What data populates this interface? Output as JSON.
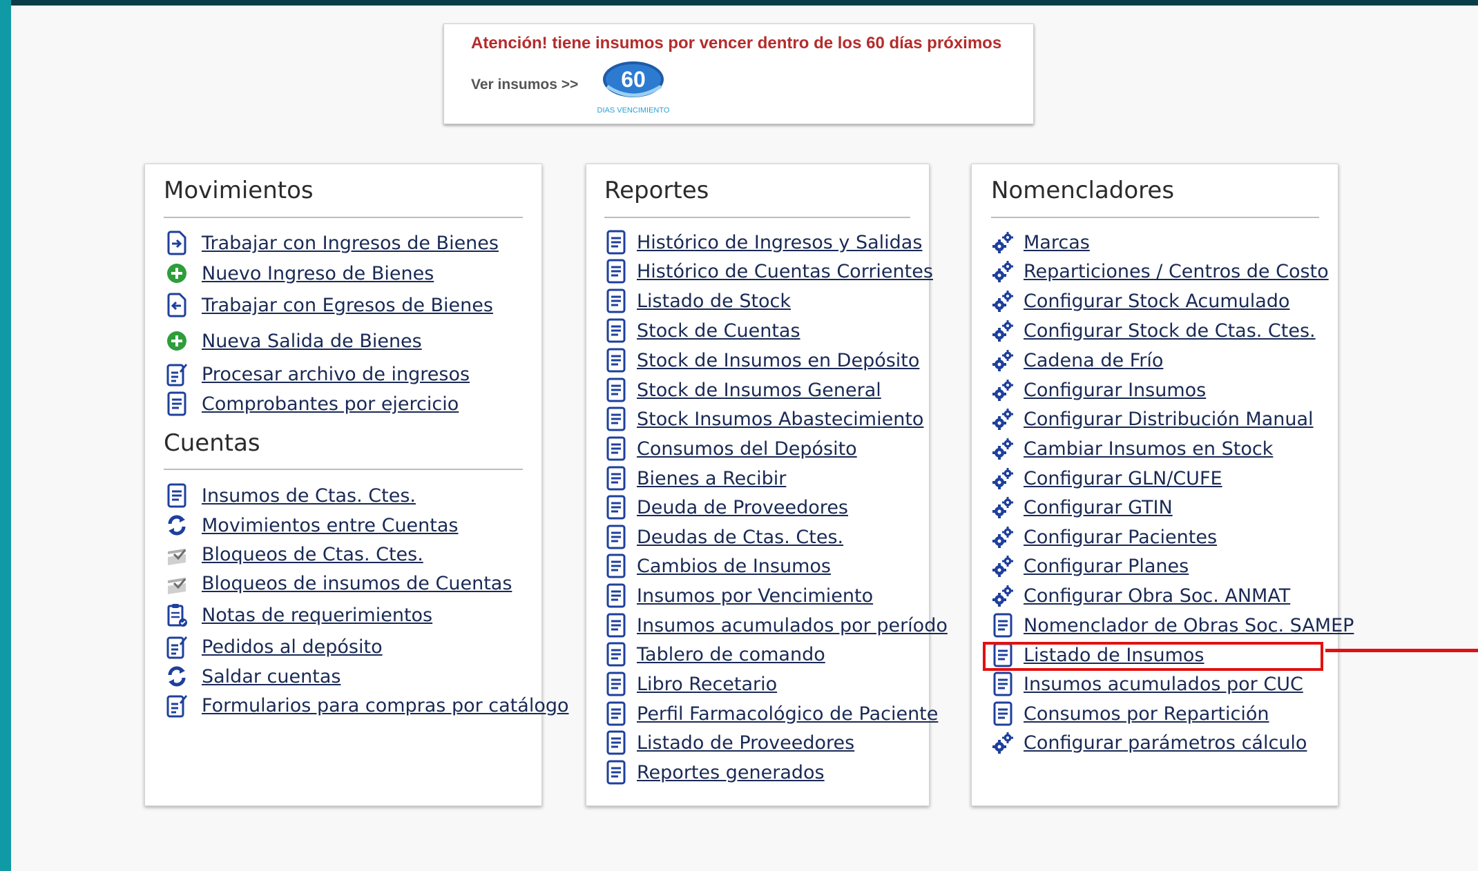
{
  "alert": {
    "title": "Atención! tiene insumos por vencer dentro de los 60 días próximos",
    "link": "Ver insumos >>",
    "badge_number": "60",
    "badge_caption": "DIAS VENCIMIENTO"
  },
  "movimientos": {
    "title": "Movimientos",
    "items": [
      {
        "label": "Trabajar con Ingresos de Bienes",
        "icon": "doc-in-icon"
      },
      {
        "label": "Nuevo Ingreso de Bienes",
        "icon": "plus-circle-icon"
      },
      {
        "label": "Trabajar con Egresos de Bienes",
        "icon": "doc-out-icon"
      },
      {
        "label": "Nueva Salida de Bienes",
        "icon": "plus-circle-icon"
      },
      {
        "label": "Procesar archivo de ingresos",
        "icon": "doc-edit-icon"
      },
      {
        "label": "Comprobantes por ejercicio",
        "icon": "doc-list-icon"
      }
    ]
  },
  "cuentas": {
    "title": "Cuentas",
    "items": [
      {
        "label": "Insumos de Ctas. Ctes.",
        "icon": "doc-list-icon"
      },
      {
        "label": "Movimientos entre Cuentas",
        "icon": "sync-icon"
      },
      {
        "label": "Bloqueos de Ctas. Ctes.",
        "icon": "lock-tray-icon"
      },
      {
        "label": "Bloqueos de insumos de Cuentas",
        "icon": "lock-tray-icon"
      },
      {
        "label": "Notas de requerimientos",
        "icon": "clipboard-icon"
      },
      {
        "label": "Pedidos al depósito",
        "icon": "doc-edit-icon"
      },
      {
        "label": "Saldar cuentas",
        "icon": "sync-icon"
      },
      {
        "label": "Formularios para compras por catálogo",
        "icon": "doc-edit-icon"
      }
    ]
  },
  "reportes": {
    "title": "Reportes",
    "items": [
      "Histórico de Ingresos y Salidas",
      "Histórico de Cuentas Corrientes",
      "Listado de Stock",
      "Stock de Cuentas",
      "Stock de Insumos en Depósito",
      "Stock de Insumos General",
      "Stock Insumos Abastecimiento",
      "Consumos del Depósito",
      "Bienes a Recibir",
      "Deuda de Proveedores",
      "Deudas de Ctas. Ctes.",
      "Cambios de Insumos",
      "Insumos por Vencimiento",
      "Insumos acumulados por período",
      "Tablero de comando",
      "Libro Recetario",
      "Perfil Farmacológico de Paciente",
      "Listado de Proveedores",
      "Reportes generados"
    ]
  },
  "nomencladores": {
    "title": "Nomencladores",
    "items": [
      {
        "label": "Marcas",
        "icon": "gears-icon"
      },
      {
        "label": "Reparticiones / Centros de Costo",
        "icon": "gears-icon"
      },
      {
        "label": "Configurar Stock Acumulado",
        "icon": "gears-icon"
      },
      {
        "label": "Configurar Stock de Ctas. Ctes.",
        "icon": "gears-icon"
      },
      {
        "label": "Cadena de Frío",
        "icon": "gears-icon"
      },
      {
        "label": "Configurar Insumos",
        "icon": "gears-icon"
      },
      {
        "label": "Configurar Distribución Manual",
        "icon": "gears-icon"
      },
      {
        "label": "Cambiar Insumos en Stock",
        "icon": "gears-icon"
      },
      {
        "label": "Configurar GLN/CUFE",
        "icon": "gears-icon"
      },
      {
        "label": "Configurar GTIN",
        "icon": "gears-icon"
      },
      {
        "label": "Configurar Pacientes",
        "icon": "gears-icon"
      },
      {
        "label": "Configurar Planes",
        "icon": "gears-icon"
      },
      {
        "label": "Configurar Obra Soc. ANMAT",
        "icon": "gears-icon"
      },
      {
        "label": "Nomenclador de Obras Soc. SAMEP",
        "icon": "doc-list-icon"
      },
      {
        "label": "Listado de Insumos",
        "icon": "doc-list-icon"
      },
      {
        "label": "Insumos acumulados por CUC",
        "icon": "doc-list-icon"
      },
      {
        "label": "Consumos por Repartición",
        "icon": "doc-list-icon"
      },
      {
        "label": "Configurar parámetros cálculo",
        "icon": "gears-icon"
      }
    ]
  },
  "colors": {
    "link": "#1a2a55",
    "icon_blue": "#1e3f9c",
    "icon_green": "#2e9d3a",
    "highlight": "#e21010",
    "frame": "#0f9aa5"
  }
}
